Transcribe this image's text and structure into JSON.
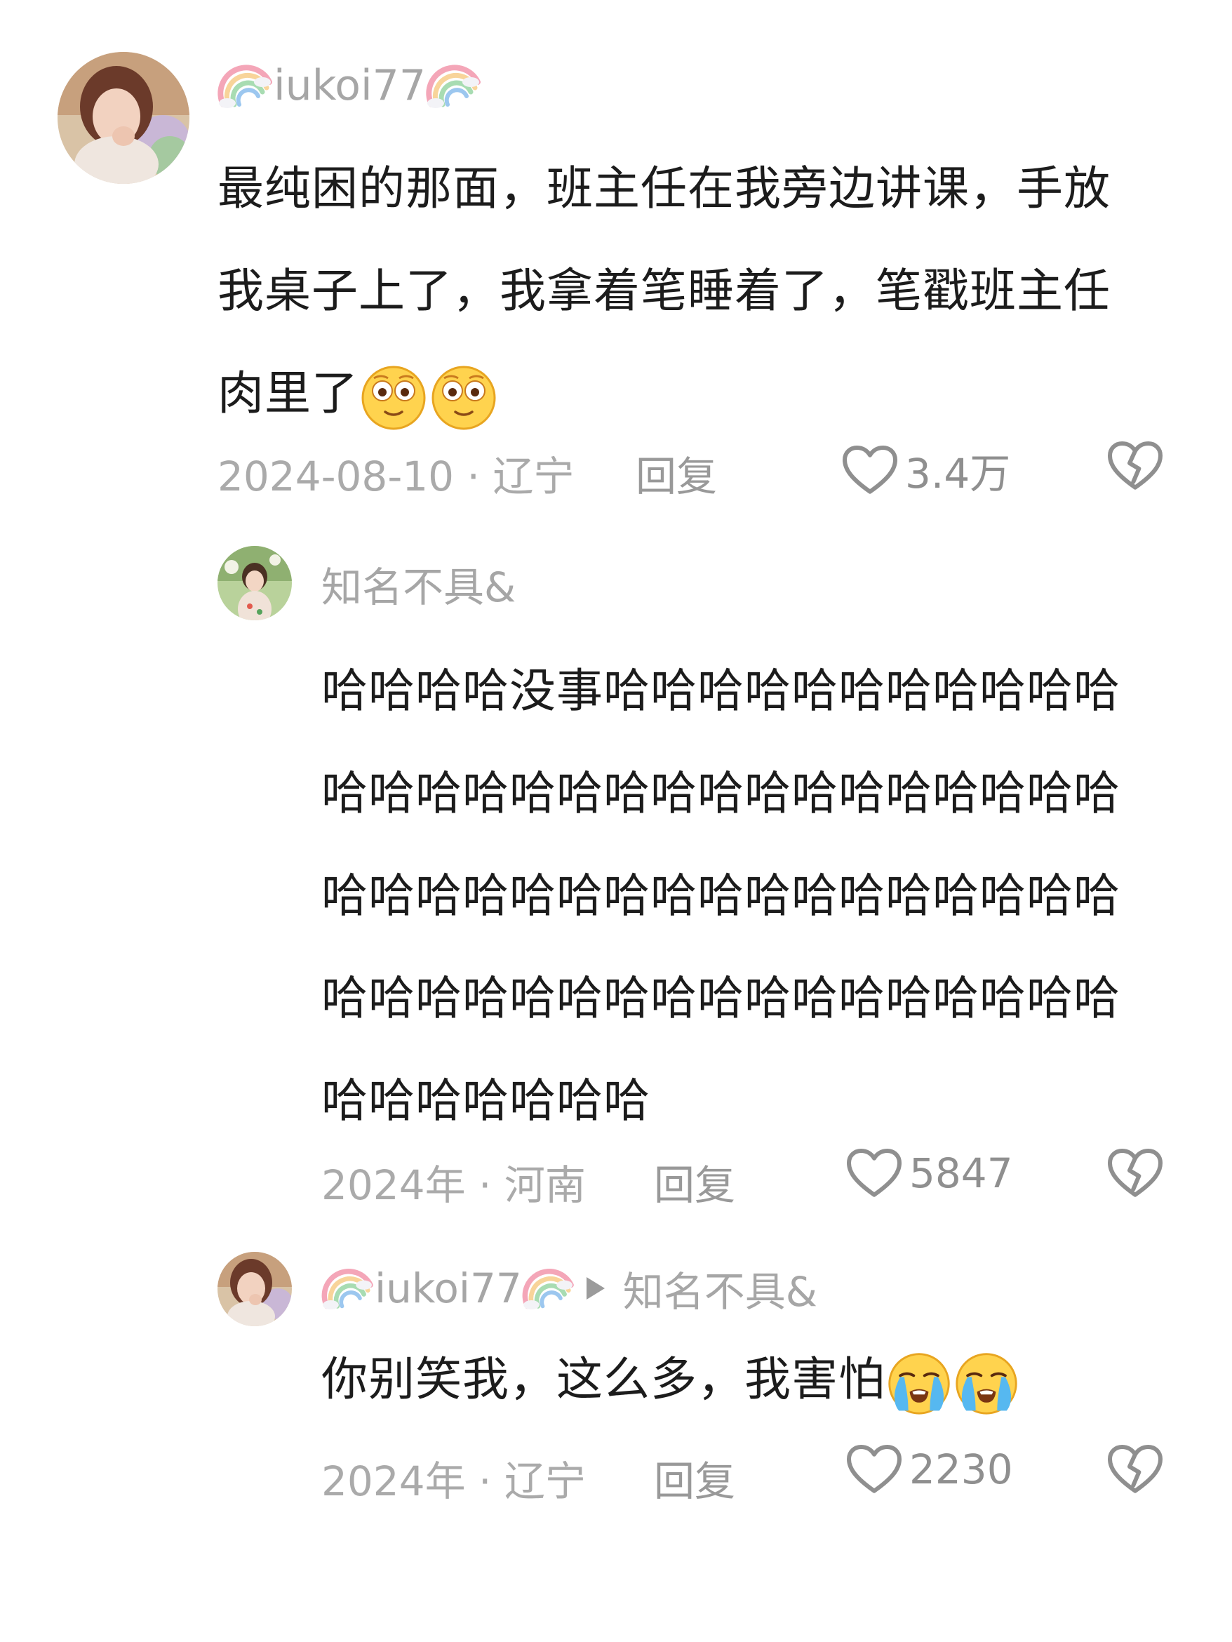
{
  "comments": [
    {
      "username": "iukoi77",
      "text": "最纯困的那面，班主任在我旁边讲课，手放我桌子上了，我拿着笔睡着了，笔戳班主任肉里了",
      "emoji": [
        "dizzy-face-emoji",
        "dizzy-face-emoji"
      ],
      "date": "2024-08-10",
      "separator": "·",
      "location": "辽宁",
      "reply_label": "回复",
      "likes": "3.4万"
    },
    {
      "username": "知名不具&",
      "text": "哈哈哈哈没事哈哈哈哈哈哈哈哈哈哈哈哈哈哈哈哈哈哈哈哈哈哈哈哈哈哈哈哈哈哈哈哈哈哈哈哈哈哈哈哈哈哈哈哈哈哈哈哈哈哈哈哈哈哈哈哈哈哈哈哈哈哈哈哈哈哈哈哈哈",
      "date": "2024年",
      "separator": "·",
      "location": "河南",
      "reply_label": "回复",
      "likes": "5847"
    },
    {
      "username": "iukoi77",
      "reply_to": "知名不具&",
      "text": "你别笑我，这么多，我害怕",
      "emoji": [
        "loudly-crying-emoji",
        "loudly-crying-emoji"
      ],
      "date": "2024年",
      "separator": "·",
      "location": "辽宁",
      "reply_label": "回复",
      "likes": "2230"
    }
  ],
  "icons": {
    "like": "heart-outline-icon",
    "dislike": "broken-heart-icon",
    "decor": "rainbow-emoji",
    "reply_arrow": "play-triangle-icon"
  },
  "colors": {
    "text_primary": "#1c1c1c",
    "text_secondary": "#a6a6a6",
    "background": "#ffffff"
  }
}
